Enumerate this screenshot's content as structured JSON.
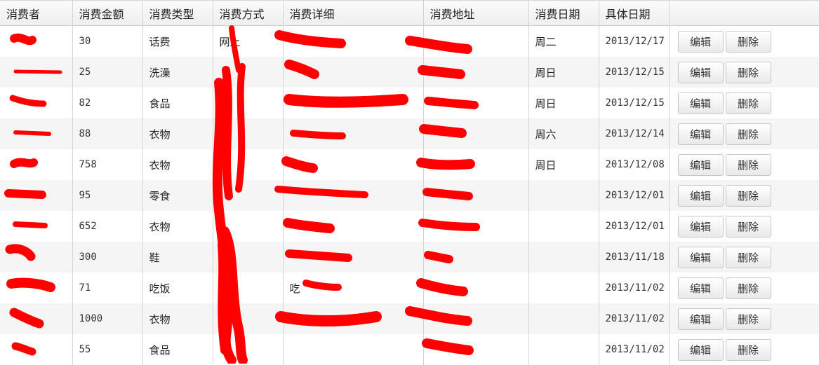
{
  "table": {
    "headers": [
      "消费者",
      "消费金额",
      "消费类型",
      "消费方式",
      "消费详细",
      "消费地址",
      "消费日期",
      "具体日期",
      ""
    ],
    "rows": [
      {
        "consumer": "",
        "amount": "30",
        "type": "话费",
        "method": "网上",
        "detail": "",
        "address": "",
        "weekday": "周二",
        "date": "2013/12/17"
      },
      {
        "consumer": "",
        "amount": "25",
        "type": "洗澡",
        "method": "",
        "detail": "",
        "address": "",
        "weekday": "周日",
        "date": "2013/12/15"
      },
      {
        "consumer": "",
        "amount": "82",
        "type": "食品",
        "method": "",
        "detail": "",
        "address": "",
        "weekday": "周日",
        "date": "2013/12/15"
      },
      {
        "consumer": "",
        "amount": "88",
        "type": "衣物",
        "method": "",
        "detail": "",
        "address": "",
        "weekday": "周六",
        "date": "2013/12/14"
      },
      {
        "consumer": "",
        "amount": "758",
        "type": "衣物",
        "method": "",
        "detail": "",
        "address": "",
        "weekday": "周日",
        "date": "2013/12/08"
      },
      {
        "consumer": "",
        "amount": "95",
        "type": "零食",
        "method": "",
        "detail": "",
        "address": "",
        "weekday": "",
        "date": "2013/12/01"
      },
      {
        "consumer": "",
        "amount": "652",
        "type": "衣物",
        "method": "",
        "detail": "",
        "address": "",
        "weekday": "",
        "date": "2013/12/01"
      },
      {
        "consumer": "",
        "amount": "300",
        "type": "鞋",
        "method": "",
        "detail": "",
        "address": "",
        "weekday": "",
        "date": "2013/11/18"
      },
      {
        "consumer": "",
        "amount": "71",
        "type": "吃饭",
        "method": "",
        "detail": "吃",
        "address": "",
        "weekday": "",
        "date": "2013/11/02"
      },
      {
        "consumer": "",
        "amount": "1000",
        "type": "衣物",
        "method": "",
        "detail": "",
        "address": "",
        "weekday": "",
        "date": "2013/11/02"
      },
      {
        "consumer": "",
        "amount": "55",
        "type": "食品",
        "method": "",
        "detail": "",
        "address": "",
        "weekday": "",
        "date": "2013/11/02"
      }
    ],
    "edit_label": "编辑",
    "delete_label": "删除"
  },
  "redaction_color": "#ff0000"
}
